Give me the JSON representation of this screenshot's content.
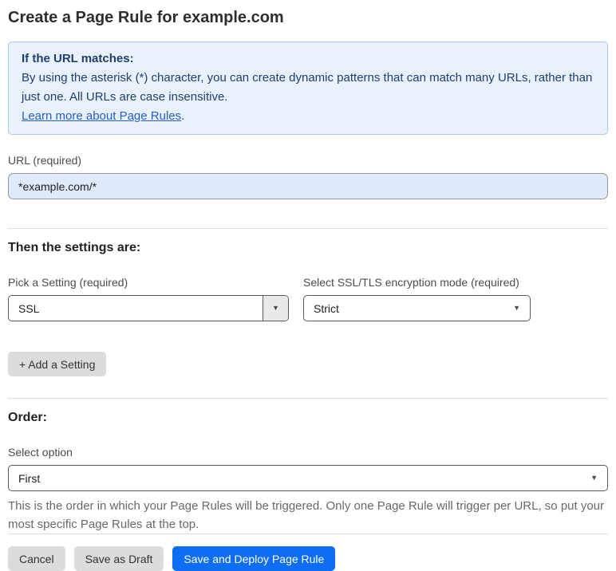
{
  "page": {
    "title": "Create a Page Rule for example.com"
  },
  "info_box": {
    "heading": "If the URL matches:",
    "body": "By using the asterisk (*) character, you can create dynamic patterns that can match many URLs, rather than just one. All URLs are case insensitive.",
    "link_label": "Learn more about Page Rules",
    "link_suffix": "."
  },
  "url_field": {
    "label": "URL (required)",
    "value": "*example.com/*"
  },
  "settings_section": {
    "heading": "Then the settings are:",
    "setting_select": {
      "label": "Pick a Setting (required)",
      "value": "SSL"
    },
    "mode_select": {
      "label": "Select SSL/TLS encryption mode (required)",
      "value": "Strict"
    },
    "add_setting_label": "+ Add a Setting"
  },
  "order_section": {
    "heading": "Order:",
    "select_label": "Select option",
    "value": "First",
    "help_text": "This is the order in which your Page Rules will be triggered. Only one Page Rule will trigger per URL, so put your most specific Page Rules at the top."
  },
  "footer": {
    "cancel_label": "Cancel",
    "save_draft_label": "Save as Draft",
    "save_deploy_label": "Save and Deploy Page Rule"
  },
  "icons": {
    "dropdown_arrow": "▼"
  },
  "colors": {
    "info_bg": "#e9f2fc",
    "info_border": "#a8cdec",
    "info_text": "#1d3e6f",
    "link": "#2360c9",
    "url_input_bg": "#dfeafc",
    "primary_button": "#0d6df4",
    "secondary_button": "#dcdcdc"
  }
}
